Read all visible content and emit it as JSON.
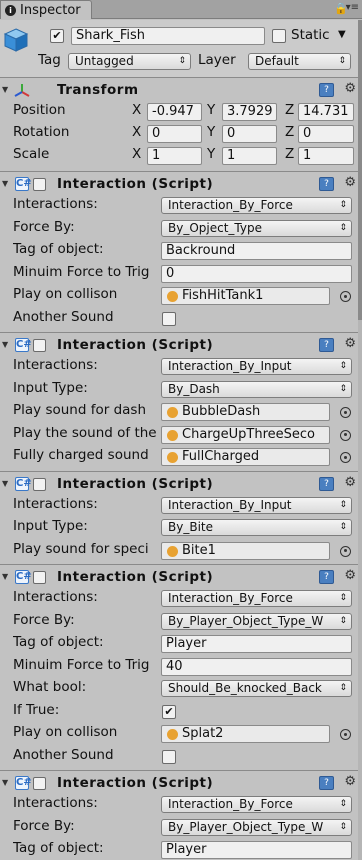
{
  "tab": {
    "title": "Inspector"
  },
  "gameobject": {
    "name": "Shark_Fish",
    "active": true,
    "static_label": "Static",
    "static": false,
    "tag_label": "Tag",
    "tag": "Untagged",
    "layer_label": "Layer",
    "layer": "Default"
  },
  "transform": {
    "title": "Transform",
    "position": {
      "label": "Position",
      "x": "-0.947",
      "y": "3.7929",
      "z": "14.731"
    },
    "rotation": {
      "label": "Rotation",
      "x": "0",
      "y": "0",
      "z": "0"
    },
    "scale": {
      "label": "Scale",
      "x": "1",
      "y": "1",
      "z": "1"
    },
    "axis": {
      "x": "X",
      "y": "Y",
      "z": "Z"
    }
  },
  "components": [
    {
      "title": "Interaction (Script)",
      "fields": [
        {
          "label": "Interactions:",
          "type": "dropdown",
          "value": "Interaction_By_Force"
        },
        {
          "label": "Force By:",
          "type": "dropdown",
          "value": "By_Opject_Type"
        },
        {
          "label": "Tag of object:",
          "type": "text",
          "value": "Backround"
        },
        {
          "label": "Minuim Force to Trig",
          "type": "text",
          "value": "0"
        },
        {
          "label": "Play on collison",
          "type": "object",
          "value": "FishHitTank1"
        },
        {
          "label": "Another Sound",
          "type": "checkbox",
          "value": false
        }
      ]
    },
    {
      "title": "Interaction (Script)",
      "fields": [
        {
          "label": "Interactions:",
          "type": "dropdown",
          "value": "Interaction_By_Input"
        },
        {
          "label": "Input Type:",
          "type": "dropdown",
          "value": "By_Dash"
        },
        {
          "label": "Play sound for dash",
          "type": "object",
          "value": "BubbleDash"
        },
        {
          "label": "Play the sound of the",
          "type": "object",
          "value": "ChargeUpThreeSeco"
        },
        {
          "label": "Fully charged sound",
          "type": "object",
          "value": "FullCharged"
        }
      ]
    },
    {
      "title": "Interaction (Script)",
      "fields": [
        {
          "label": "Interactions:",
          "type": "dropdown",
          "value": "Interaction_By_Input"
        },
        {
          "label": "Input Type:",
          "type": "dropdown",
          "value": "By_Bite"
        },
        {
          "label": "Play sound for speci",
          "type": "object",
          "value": "Bite1"
        }
      ]
    },
    {
      "title": "Interaction (Script)",
      "fields": [
        {
          "label": "Interactions:",
          "type": "dropdown",
          "value": "Interaction_By_Force"
        },
        {
          "label": "Force By:",
          "type": "dropdown",
          "value": "By_Player_Object_Type_W"
        },
        {
          "label": "Tag of object:",
          "type": "text",
          "value": "Player"
        },
        {
          "label": "Minuim Force to Trig",
          "type": "text",
          "value": "40"
        },
        {
          "label": "What bool:",
          "type": "dropdown",
          "value": "Should_Be_knocked_Back"
        },
        {
          "label": "If True:",
          "type": "checkbox",
          "value": true
        },
        {
          "label": "Play on collison",
          "type": "object",
          "value": "Splat2"
        },
        {
          "label": "Another Sound",
          "type": "checkbox",
          "value": false
        }
      ]
    },
    {
      "title": "Interaction (Script)",
      "fields": [
        {
          "label": "Interactions:",
          "type": "dropdown",
          "value": "Interaction_By_Force"
        },
        {
          "label": "Force By:",
          "type": "dropdown",
          "value": "By_Player_Object_Type_W"
        },
        {
          "label": "Tag of object:",
          "type": "text",
          "value": "Player"
        }
      ]
    }
  ]
}
